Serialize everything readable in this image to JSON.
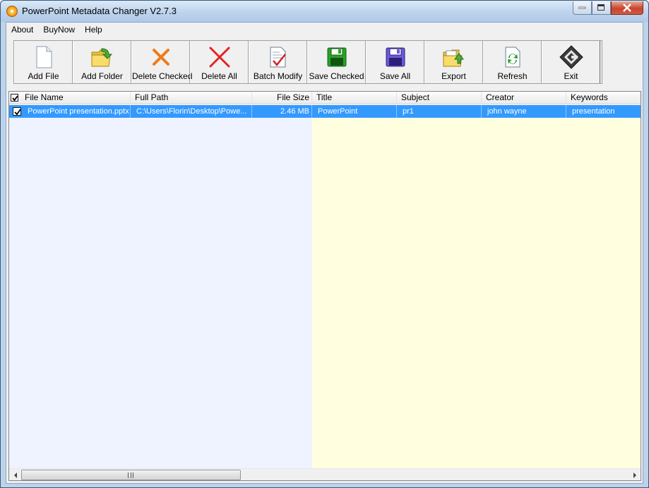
{
  "window": {
    "title": "PowerPoint Metadata Changer V2.7.3",
    "icon": "app-logo-icon"
  },
  "menu": [
    {
      "label": "About"
    },
    {
      "label": "BuyNow"
    },
    {
      "label": "Help"
    }
  ],
  "toolbar": [
    {
      "label": "Add File",
      "icon": "blank-document-icon"
    },
    {
      "label": "Add Folder",
      "icon": "folder-add-icon"
    },
    {
      "label": "Delete Checked",
      "icon": "orange-x-icon"
    },
    {
      "label": "Delete All",
      "icon": "red-x-icon"
    },
    {
      "label": "Batch Modify",
      "icon": "document-check-icon"
    },
    {
      "label": "Save Checked",
      "icon": "green-floppy-icon"
    },
    {
      "label": "Save All",
      "icon": "blue-floppy-icon"
    },
    {
      "label": "Export",
      "icon": "folder-export-icon"
    },
    {
      "label": "Refresh",
      "icon": "refresh-document-icon"
    },
    {
      "label": "Exit",
      "icon": "exit-diamond-icon"
    }
  ],
  "columns": [
    {
      "label": "File Name"
    },
    {
      "label": "Full Path"
    },
    {
      "label": "File Size"
    },
    {
      "label": "Title"
    },
    {
      "label": "Subject"
    },
    {
      "label": "Creator"
    },
    {
      "label": "Keywords"
    }
  ],
  "rows": [
    {
      "checked": true,
      "selected": true,
      "cells": [
        "PowerPoint presentation.pptx",
        "C:\\Users\\Florin\\Desktop\\Powe...",
        "2.46 MB",
        "PowerPoint",
        "pr1",
        "john wayne",
        "presentation"
      ]
    }
  ],
  "scrollbar": {
    "grip": "III"
  },
  "colors": {
    "selection": "#3399ff",
    "left_band": "#eef3ff",
    "right_band": "#ffffe0"
  }
}
